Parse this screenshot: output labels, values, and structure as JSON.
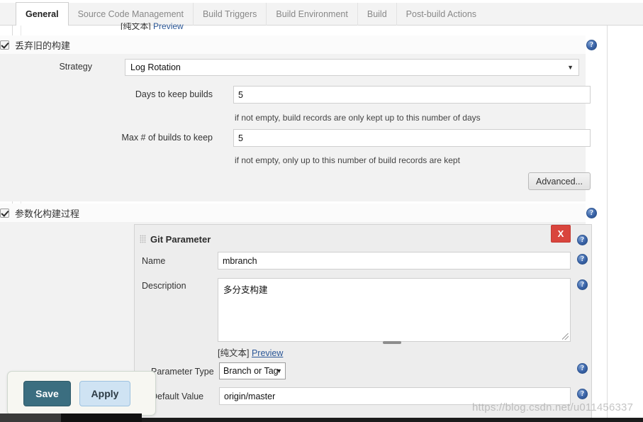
{
  "window": {
    "watermark": "https://blog.csdn.net/u011456337"
  },
  "tabs": [
    {
      "label": "General",
      "active": true
    },
    {
      "label": "Source Code Management",
      "active": false
    },
    {
      "label": "Build Triggers",
      "active": false
    },
    {
      "label": "Build Environment",
      "active": false
    },
    {
      "label": "Build",
      "active": false
    },
    {
      "label": "Post-build Actions",
      "active": false
    }
  ],
  "clipped_top": {
    "plain_text": "[纯文本]",
    "preview_link": "Preview"
  },
  "discard_builds": {
    "checkbox_label": "丢弃旧的构建",
    "checked": true,
    "help_icon": "help-icon",
    "strategy": {
      "label": "Strategy",
      "value": "Log Rotation",
      "caret": "▼"
    },
    "days_to_keep": {
      "label": "Days to keep builds",
      "value": "5",
      "hint": "if not empty, build records are only kept up to this number of days",
      "help_icon": "help-icon"
    },
    "max_builds": {
      "label": "Max # of builds to keep",
      "value": "5",
      "hint": "if not empty, only up to this number of build records are kept",
      "help_icon": "help-icon"
    },
    "advanced_button": "Advanced..."
  },
  "parameterized_build": {
    "checkbox_label": "参数化构建过程",
    "checked": true,
    "help_icon": "help-icon",
    "git_parameter": {
      "title": "Git Parameter",
      "grip_icon": "drag-handle-icon",
      "delete_button": "X",
      "name": {
        "label": "Name",
        "value": "mbranch",
        "help_icon": "help-icon"
      },
      "description": {
        "label": "Description",
        "value": "多分支构建",
        "help_icon": "help-icon",
        "plain_text": "[纯文本]",
        "preview_link": "Preview"
      },
      "parameter_type": {
        "label": "Parameter Type",
        "value": "Branch or Tag",
        "caret": "▼",
        "help_icon": "help-icon"
      },
      "default_value": {
        "label": "Default Value",
        "value": "origin/master",
        "help_icon": "help-icon"
      }
    }
  },
  "action_bar": {
    "save_label": "Save",
    "apply_label": "Apply"
  },
  "colors": {
    "save_bg": "#3b6e80",
    "apply_bg": "#cfe3f3",
    "delete_bg": "#d9453d",
    "help_blue": "#3a64a8"
  }
}
